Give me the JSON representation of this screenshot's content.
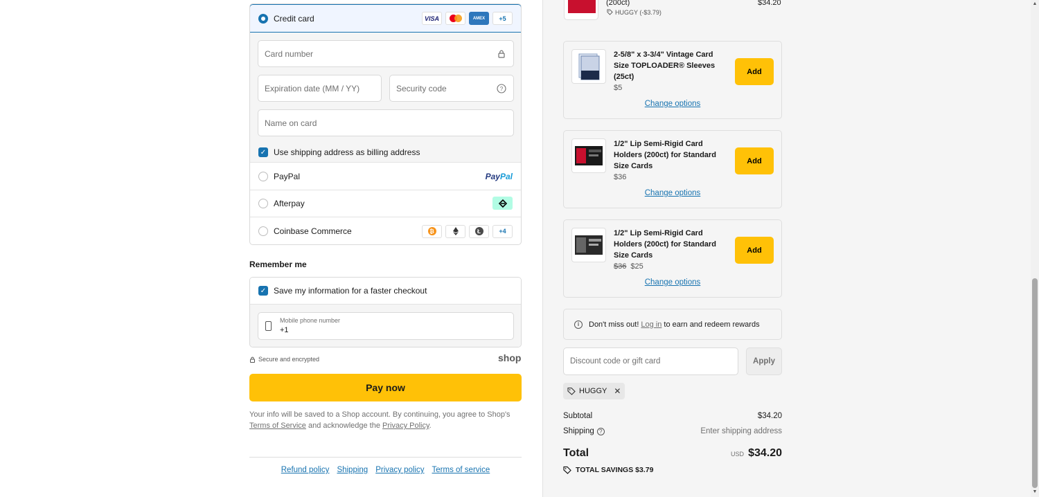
{
  "payment": {
    "methods": [
      {
        "label": "Credit card",
        "selected": true
      },
      {
        "label": "PayPal"
      },
      {
        "label": "Afterpay"
      },
      {
        "label": "Coinbase Commerce"
      }
    ],
    "card_brands": {
      "visa": "VISA",
      "amex": "AMEX",
      "more": "+5"
    },
    "crypto_more": "+4",
    "paypal_logo_a": "Pay",
    "paypal_logo_b": "Pal",
    "fields": {
      "card_number": "Card number",
      "expiration": "Expiration date (MM / YY)",
      "security_code": "Security code",
      "name_on_card": "Name on card"
    },
    "billing_checkbox": "Use shipping address as billing address"
  },
  "remember": {
    "title": "Remember me",
    "save_label": "Save my information for a faster checkout",
    "phone_label": "Mobile phone number",
    "phone_value": "+1"
  },
  "secure_text": "Secure and encrypted",
  "shop_logo": "shop",
  "pay_button": "Pay now",
  "legal": {
    "text1": "Your info will be saved to a Shop account. By continuing, you agree to Shop's",
    "tos": "Terms of Service",
    "text2": "and acknowledge the",
    "privacy": "Privacy Policy",
    "end": "."
  },
  "footer": [
    "Refund policy",
    "Shipping",
    "Privacy policy",
    "Terms of service"
  ],
  "order": {
    "top_item": {
      "name": "(200ct)",
      "discount": "HUGGY (-$3.79)",
      "price": "$34.20"
    },
    "recommendations": [
      {
        "name": "2-5/8\" x 3-3/4\" Vintage Card Size TOPLOADER® Sleeves (25ct)",
        "price": "$5",
        "compare_price": "",
        "add": "Add",
        "change": "Change options"
      },
      {
        "name": "1/2\" Lip Semi-Rigid Card Holders (200ct) for Standard Size Cards",
        "price": "$36",
        "compare_price": "",
        "add": "Add",
        "change": "Change options"
      },
      {
        "name": "1/2\" Lip Semi-Rigid Card Holders (200ct) for Standard Size Cards",
        "price": "$25",
        "compare_price": "$36",
        "add": "Add",
        "change": "Change options"
      }
    ],
    "rewards": {
      "text1": "Don't miss out!",
      "link": "Log in",
      "text2": "to earn and redeem rewards"
    },
    "discount_placeholder": "Discount code or gift card",
    "apply": "Apply",
    "applied_code": "HUGGY",
    "subtotal_label": "Subtotal",
    "subtotal": "$34.20",
    "shipping_label": "Shipping",
    "shipping_value": "Enter shipping address",
    "total_label": "Total",
    "currency": "USD",
    "total": "$34.20",
    "savings_label": "TOTAL SAVINGS",
    "savings": "$3.79"
  },
  "colors": {
    "accent": "#1773b0",
    "pay_button": "#ffc107",
    "sidebar_bg": "#f5f5f5"
  }
}
